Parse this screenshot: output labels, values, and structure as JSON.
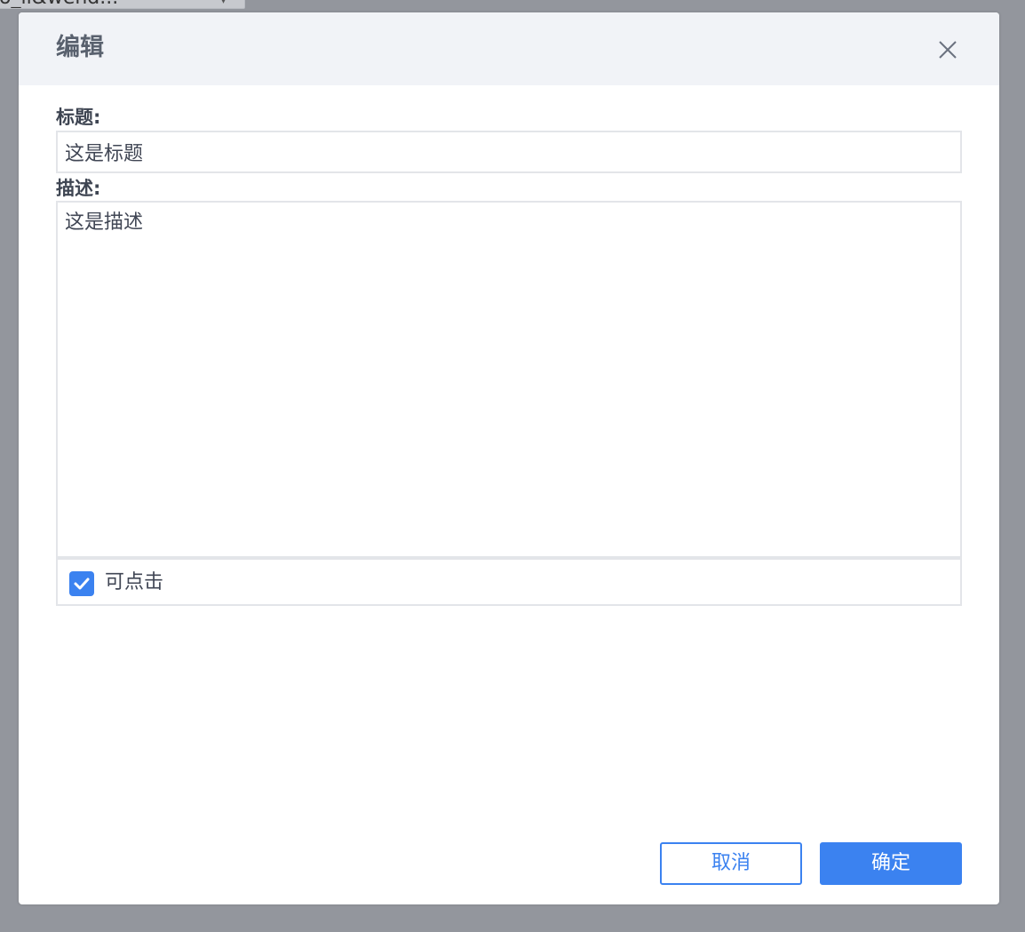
{
  "background": {
    "fragment_text": "o_ii&wend..."
  },
  "dialog": {
    "title": "编辑",
    "close_icon": "close-icon",
    "fields": {
      "title_label": "标题:",
      "title_value": "这是标题",
      "desc_label": "描述:",
      "desc_value": "这是描述"
    },
    "checkbox": {
      "label": "可点击",
      "checked": true
    },
    "buttons": {
      "cancel_label": "取消",
      "ok_label": "确定"
    }
  },
  "colors": {
    "accent": "#3b82f0",
    "header_bg": "#f1f3f7",
    "overlay": "#93969d"
  }
}
